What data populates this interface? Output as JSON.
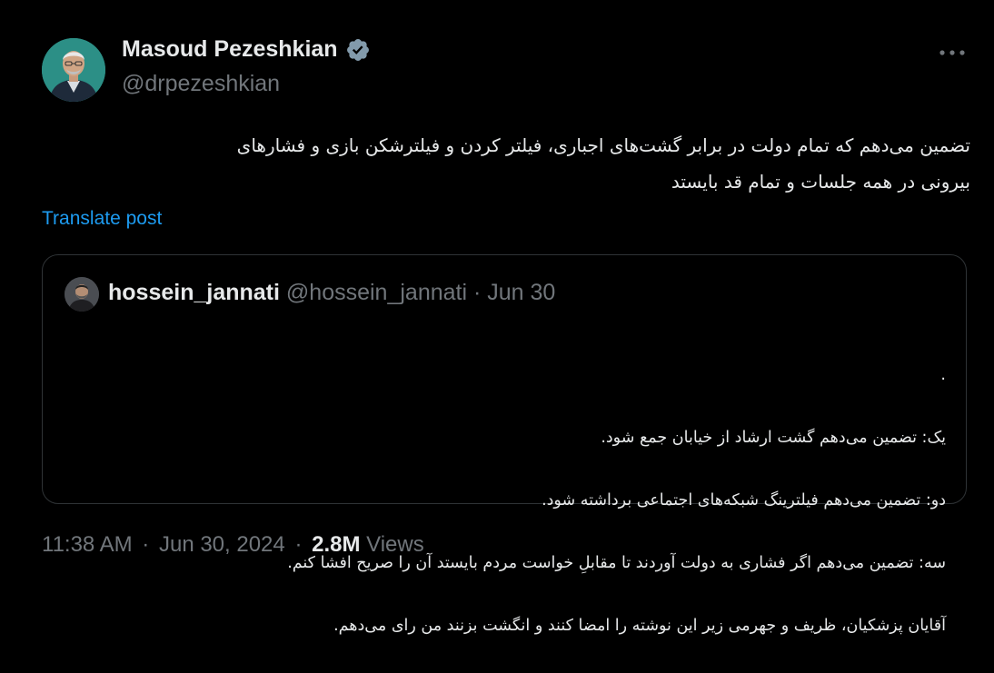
{
  "author": {
    "display_name": "Masoud Pezeshkian",
    "handle": "@drpezeshkian",
    "verified": true,
    "verified_color": "#829aab",
    "avatar_bg": "#2c8f86"
  },
  "tweet": {
    "text": "تضمین می‌دهم که تمام دولت در برابر  گشت‌های اجباری، فیلتر کردن و فیلترشکن بازی و فشارهای\nبیرونی در  همه جلسات و تمام قد بایستد",
    "translate_label": "Translate post"
  },
  "quote": {
    "name": "hossein_jannati",
    "handle": "@hossein_jannati",
    "date": "Jun 30",
    "separator": "·",
    "lines": [
      ".",
      "یک: تضمین می‌دهم گشت ارشاد از خیابان جمع شود.",
      "دو: تضمین می‌دهم فیلترینگ شبکه‌های اجتماعی برداشته شود.",
      "سه: تضمین می‌دهم اگر فشاری به دولت آوردند تا مقابلِ خواست مردم بایستد آن را صریح افشا کنم.",
      "آقایان پزشکیان، ظریف و جهرمی زیر این نوشته را امضا کنند و انگشت بزنند من رای می‌دهم."
    ]
  },
  "footer": {
    "time": "11:38 AM",
    "date": "Jun 30, 2024",
    "separator": "·",
    "views_count": "2.8M",
    "views_label": "Views"
  },
  "colors": {
    "background": "#000000",
    "text": "#e7e9ea",
    "secondary": "#71767b",
    "link": "#1d9bf0",
    "border": "#2f3336"
  },
  "icons": {
    "more": "more-horizontal-icon",
    "verified": "verified-badge-icon"
  }
}
